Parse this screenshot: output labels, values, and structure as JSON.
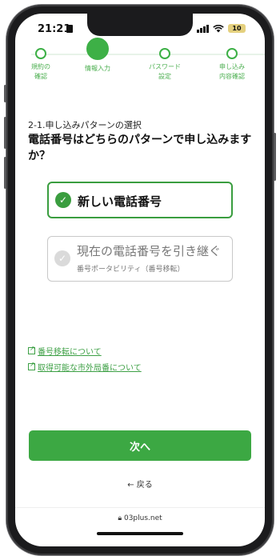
{
  "status_bar": {
    "time": "21:21",
    "battery": "10"
  },
  "steps": [
    {
      "line1": "規約の",
      "line2": "確認",
      "state": "done"
    },
    {
      "line1": "情報入力",
      "line2": "",
      "state": "active"
    },
    {
      "line1": "パスワード",
      "line2": "設定",
      "state": "todo"
    },
    {
      "line1": "申し込み",
      "line2": "内容確認",
      "state": "todo"
    }
  ],
  "section_label": "2-1.申し込みパターンの選択",
  "question": "電話番号はどちらのパターンで申し込みますか？",
  "options": [
    {
      "title": "新しい電話番号",
      "subtitle": "",
      "selected": true
    },
    {
      "title": "現在の電話番号を引き継ぐ",
      "subtitle": "番号ポータビリティ（番号移転）",
      "selected": false
    }
  ],
  "links": [
    "番号移転について",
    "取得可能な市外局番について"
  ],
  "next_button": "次へ",
  "back_link": "← 戻る",
  "url": "03plus.net",
  "colors": {
    "accent": "#3ca843",
    "frame": "#1b1b1d"
  }
}
